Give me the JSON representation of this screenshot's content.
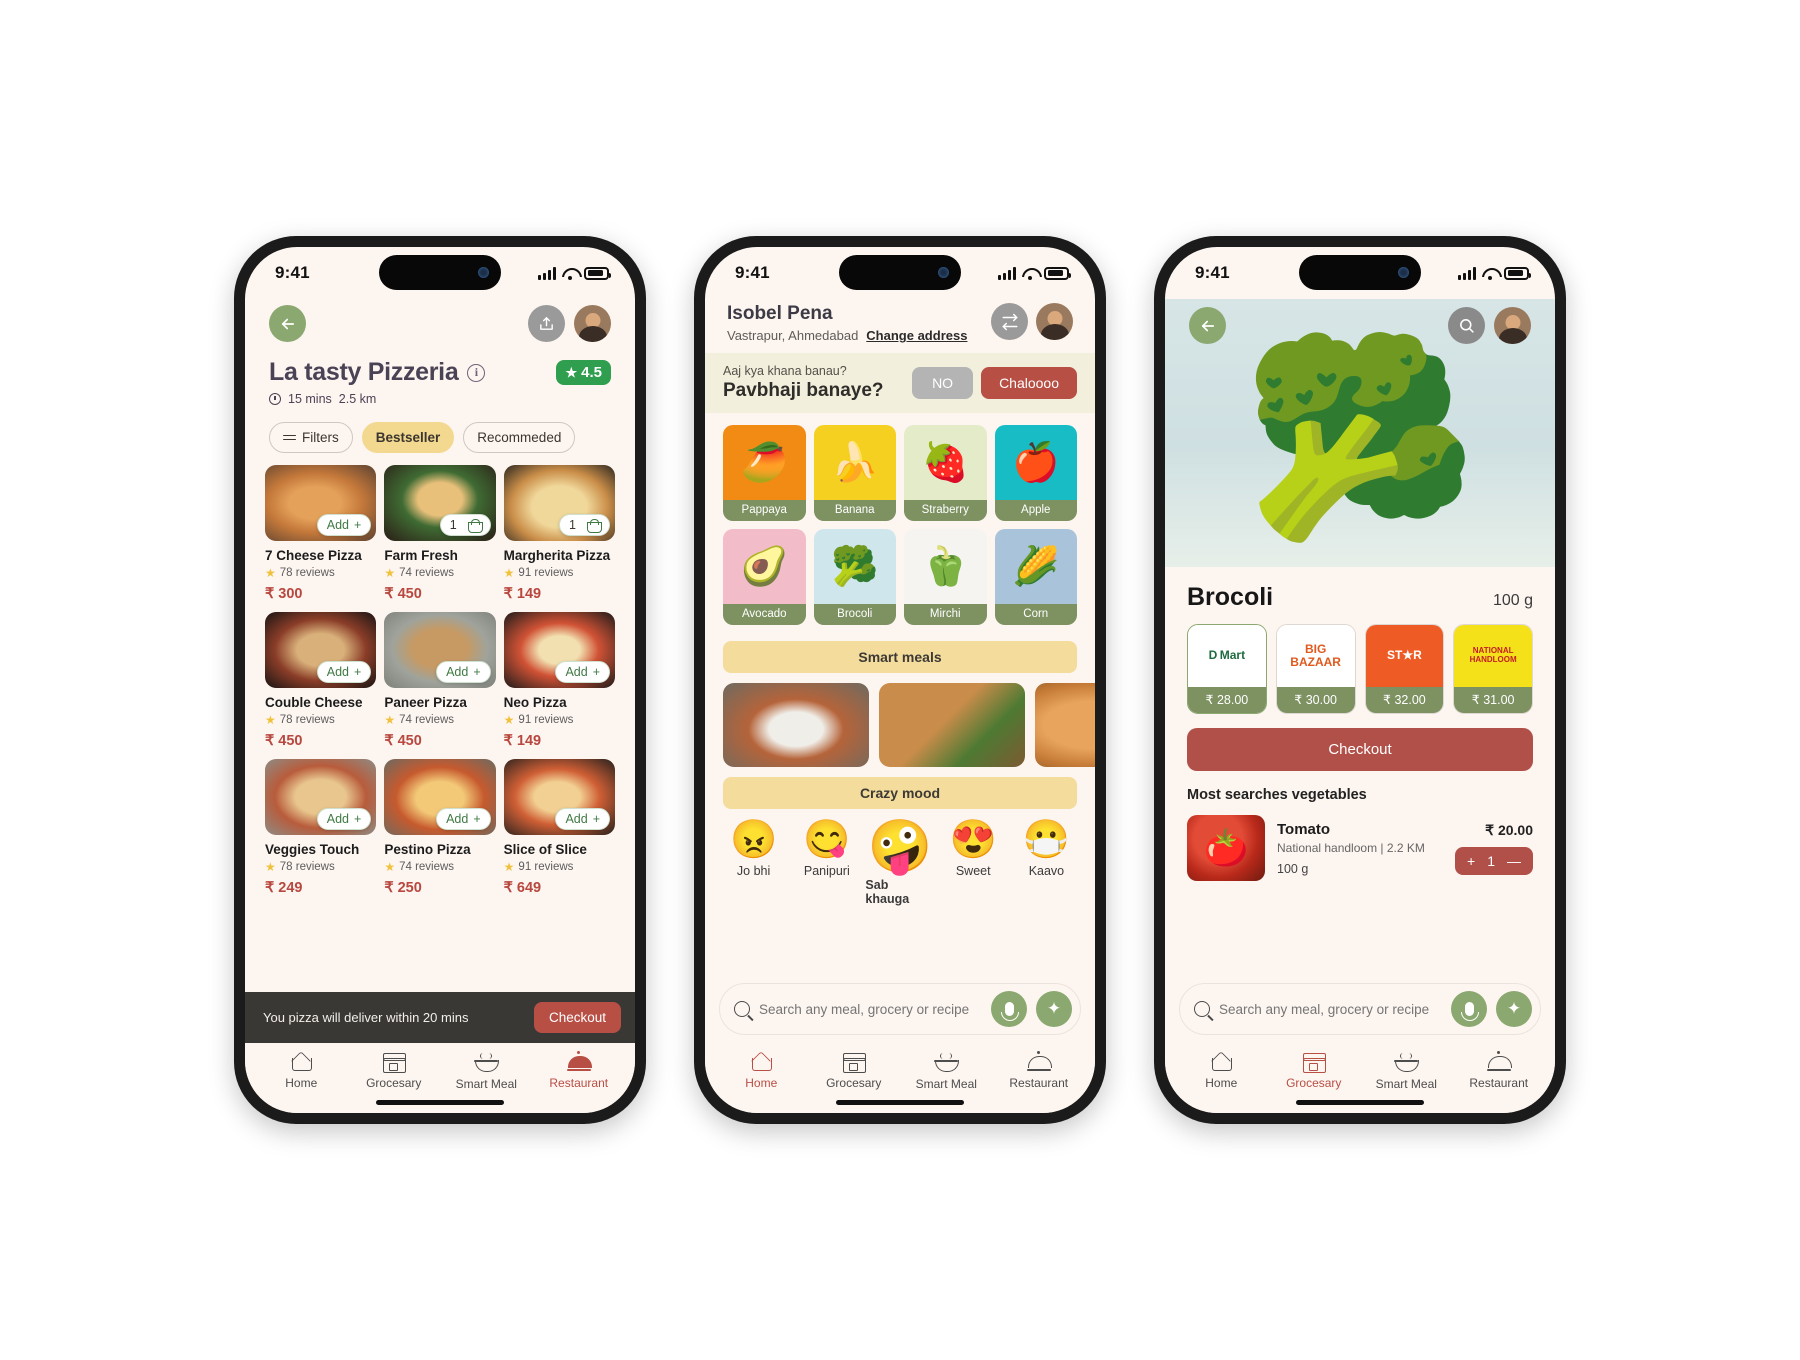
{
  "status_bar": {
    "time": "9:41",
    "signal_icon": "cellular-bars-icon",
    "wifi_icon": "wifi-icon",
    "battery_icon": "battery-icon"
  },
  "phone1": {
    "back_icon": "back-arrow-icon",
    "share_icon": "share-icon",
    "avatar_name": "user-avatar",
    "title": "La tasty Pizzeria",
    "info_icon": "info-icon",
    "rating": "4.5",
    "rating_star": "★",
    "meta": {
      "time": "15 mins",
      "distance": "2.5 km"
    },
    "filters": [
      {
        "label": "Filters",
        "active": false,
        "icon": "filter-icon"
      },
      {
        "label": "Bestseller",
        "active": true
      },
      {
        "label": "Recommeded",
        "active": false
      }
    ],
    "items": [
      {
        "name": "7 Cheese Pizza",
        "reviews": "78 reviews",
        "price": "₹ 300",
        "cta": "Add",
        "cta_type": "add"
      },
      {
        "name": "Farm Fresh",
        "reviews": "74 reviews",
        "price": "₹ 450",
        "cta": "1",
        "cta_type": "qty"
      },
      {
        "name": "Margherita Pizza",
        "reviews": "91 reviews",
        "price": "₹ 149",
        "cta": "1",
        "cta_type": "qty"
      },
      {
        "name": "Couble Cheese",
        "reviews": "78 reviews",
        "price": "₹ 450",
        "cta": "Add",
        "cta_type": "add"
      },
      {
        "name": "Paneer Pizza",
        "reviews": "74 reviews",
        "price": "₹ 450",
        "cta": "Add",
        "cta_type": "add"
      },
      {
        "name": "Neo Pizza",
        "reviews": "91 reviews",
        "price": "₹ 149",
        "cta": "Add",
        "cta_type": "add"
      },
      {
        "name": "Veggies Touch",
        "reviews": "78 reviews",
        "price": "₹ 249",
        "cta": "Add",
        "cta_type": "add"
      },
      {
        "name": "Pestino Pizza",
        "reviews": "74 reviews",
        "price": "₹ 250",
        "cta": "Add",
        "cta_type": "add"
      },
      {
        "name": "Slice of Slice",
        "reviews": "91 reviews",
        "price": "₹ 649",
        "cta": "Add",
        "cta_type": "add"
      }
    ],
    "delivery_note": "You pizza will deliver within 20 mins",
    "checkout_label": "Checkout",
    "tabs": [
      {
        "label": "Home",
        "icon": "home-icon",
        "active": false
      },
      {
        "label": "Grocesary",
        "icon": "store-icon",
        "active": false
      },
      {
        "label": "Smart Meal",
        "icon": "bowl-icon",
        "active": false
      },
      {
        "label": "Restaurant",
        "icon": "dish-cloche-icon",
        "active": true
      }
    ]
  },
  "phone2": {
    "user_name": "Isobel Pena",
    "address": "Vastrapur, Ahmedabad",
    "change_address": "Change address",
    "swap_icon": "swap-refresh-icon",
    "avatar_name": "user-avatar",
    "banner": {
      "question": "Aaj kya khana banau?",
      "suggestion": "Pavbhaji banaye?",
      "no_label": "NO",
      "yes_label": "Chaloooo"
    },
    "veggies": [
      {
        "label": "Pappaya",
        "emoji": "🥭",
        "bg": "#F28B13"
      },
      {
        "label": "Banana",
        "emoji": "🍌",
        "bg": "#F5D021"
      },
      {
        "label": "Straberry",
        "emoji": "🍓",
        "bg": "#E4EBC8"
      },
      {
        "label": "Apple",
        "emoji": "🍎",
        "bg": "#17BCC4"
      },
      {
        "label": "Avocado",
        "emoji": "🥑",
        "bg": "#F3BCC9"
      },
      {
        "label": "Brocoli",
        "emoji": "🥦",
        "bg": "#CFE6EC"
      },
      {
        "label": "Mirchi",
        "emoji": "🫑",
        "bg": "#F6F4F1"
      },
      {
        "label": "Corn",
        "emoji": "🌽",
        "bg": "#A9C4DA"
      }
    ],
    "smart_meals_label": "Smart meals",
    "meals": [
      {
        "name": "curry-rice-bowl",
        "color": "#9d9a90"
      },
      {
        "name": "samosa-plate",
        "color": "#b07a45"
      },
      {
        "name": "bread-pav",
        "color": "#d8a868"
      }
    ],
    "crazy_mood_label": "Crazy mood",
    "moods": [
      {
        "label": "Jo bhi",
        "emoji": "😠",
        "big": false
      },
      {
        "label": "Panipuri",
        "emoji": "😋",
        "big": false
      },
      {
        "label": "Sab khauga",
        "emoji": "🤪",
        "big": true
      },
      {
        "label": "Sweet",
        "emoji": "😍",
        "big": false
      },
      {
        "label": "Kaavo",
        "emoji": "😷",
        "big": false
      }
    ],
    "search": {
      "placeholder": "Search any meal, grocery or recipe",
      "search_icon": "search-icon",
      "mic_icon": "microphone-icon",
      "ai_icon": "sparkle-ai-icon"
    },
    "tabs": [
      {
        "label": "Home",
        "icon": "home-icon",
        "active": true
      },
      {
        "label": "Grocesary",
        "icon": "store-icon",
        "active": false
      },
      {
        "label": "Smart Meal",
        "icon": "bowl-icon",
        "active": false
      },
      {
        "label": "Restaurant",
        "icon": "dish-cloche-icon",
        "active": false
      }
    ]
  },
  "phone3": {
    "back_icon": "back-arrow-icon",
    "search_icon": "search-icon",
    "avatar_name": "user-avatar",
    "hero_emoji": "🥦",
    "product_title": "Brocoli",
    "product_weight": "100 g",
    "brands": [
      {
        "name": "DMart",
        "price": "₹ 28.00",
        "logo_text": "D Mart",
        "color": "#1d6b3f",
        "bg": "#ffffff",
        "selected": true
      },
      {
        "name": "BIG BAZAAR",
        "price": "₹ 30.00",
        "logo_text": "BIG BAZAAR",
        "color": "#e05a1e",
        "bg": "#ffffff",
        "selected": false
      },
      {
        "name": "STAR Bazaar",
        "price": "₹ 32.00",
        "logo_text": "ST★R",
        "color": "#ffffff",
        "bg": "#ee5b24",
        "selected": false
      },
      {
        "name": "NATIONAL HANDLOOM",
        "price": "₹ 31.00",
        "logo_text": "NATIONAL HANDLOOM",
        "color": "#c41e24",
        "bg": "#f5e11a",
        "selected": false
      }
    ],
    "checkout_label": "Checkout",
    "most_searched_title": "Most searches vegetables",
    "suggestion": {
      "name": "Tomato",
      "emoji": "🍅",
      "subtitle": "National handloom | 2.2 KM",
      "weight": "100 g",
      "price": "₹ 20.00",
      "qty": "1",
      "plus": "+",
      "minus": "—"
    },
    "search": {
      "placeholder": "Search any meal, grocery or recipe",
      "search_icon": "search-icon",
      "mic_icon": "microphone-icon",
      "ai_icon": "sparkle-ai-icon"
    },
    "tabs": [
      {
        "label": "Home",
        "icon": "home-icon",
        "active": false
      },
      {
        "label": "Grocesary",
        "icon": "store-icon",
        "active": true
      },
      {
        "label": "Smart Meal",
        "icon": "bowl-icon",
        "active": false
      },
      {
        "label": "Restaurant",
        "icon": "dish-cloche-icon",
        "active": false
      }
    ]
  }
}
